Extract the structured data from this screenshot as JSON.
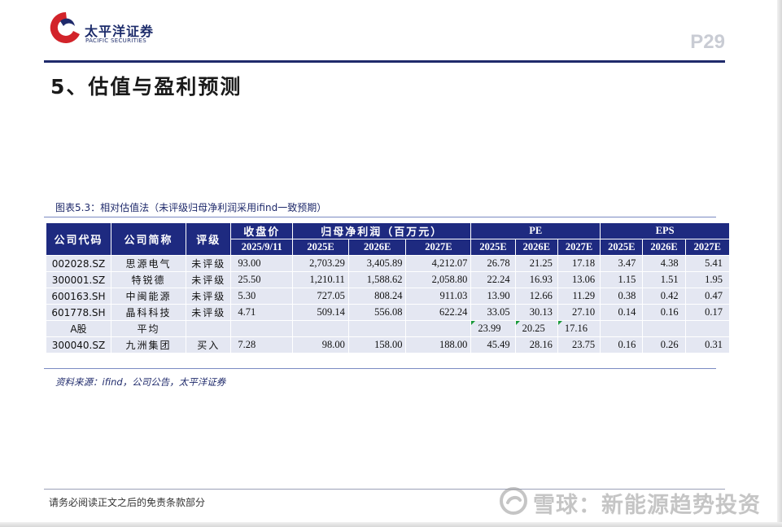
{
  "header": {
    "brand_cn": "太平洋证券",
    "brand_en": "PACIFIC SECURITIES",
    "page_number": "P29"
  },
  "section_title": "5、估值与盈利预测",
  "figure": {
    "caption": "图表5.3：相对估值法（未评级归母净利润采用ifind一致预期）",
    "source": "资料来源：ifind，公司公告，太平洋证券"
  },
  "table": {
    "headers": {
      "code": "公司代码",
      "name": "公司简称",
      "rating": "评级",
      "close": "收盘价",
      "close_date": "2025/9/11",
      "profit": "归母净利润（百万元）",
      "pe": "PE",
      "eps": "EPS",
      "years": [
        "2025E",
        "2026E",
        "2027E"
      ]
    },
    "rows": [
      {
        "code": "002028.SZ",
        "name": "思源电气",
        "rating": "未评级",
        "close": "93.00",
        "profit": [
          "2,703.29",
          "3,405.89",
          "4,212.07"
        ],
        "pe": [
          "26.78",
          "21.25",
          "17.18"
        ],
        "eps": [
          "3.47",
          "4.38",
          "5.41"
        ]
      },
      {
        "code": "300001.SZ",
        "name": "特锐德",
        "rating": "未评级",
        "close": "25.50",
        "profit": [
          "1,210.11",
          "1,588.62",
          "2,058.80"
        ],
        "pe": [
          "22.24",
          "16.93",
          "13.06"
        ],
        "eps": [
          "1.15",
          "1.51",
          "1.95"
        ]
      },
      {
        "code": "600163.SH",
        "name": "中闽能源",
        "rating": "未评级",
        "close": "5.30",
        "profit": [
          "727.05",
          "808.24",
          "911.03"
        ],
        "pe": [
          "13.90",
          "12.66",
          "11.29"
        ],
        "eps": [
          "0.38",
          "0.42",
          "0.47"
        ]
      },
      {
        "code": "601778.SH",
        "name": "晶科科技",
        "rating": "未评级",
        "close": "4.71",
        "profit": [
          "509.14",
          "556.08",
          "622.24"
        ],
        "pe": [
          "33.05",
          "30.13",
          "27.10"
        ],
        "eps": [
          "0.14",
          "0.16",
          "0.17"
        ]
      },
      {
        "code": "A股",
        "name": "平均",
        "rating": "",
        "close": "",
        "profit": [
          "",
          "",
          ""
        ],
        "pe": [
          "23.99",
          "20.25",
          "17.16"
        ],
        "eps": [
          "",
          "",
          ""
        ]
      },
      {
        "code": "300040.SZ",
        "name": "九洲集团",
        "rating": "买入",
        "close": "7.28",
        "profit": [
          "98.00",
          "158.00",
          "188.00"
        ],
        "pe": [
          "45.49",
          "28.16",
          "23.75"
        ],
        "eps": [
          "0.16",
          "0.26",
          "0.31"
        ]
      }
    ]
  },
  "footer": {
    "disclaimer": "请务必阅读正文之后的免责条款部分",
    "watermark": "雪球：新能源趋势投资"
  },
  "colors": {
    "brand_navy": "#1f2a6b",
    "header_fill": "#1e2a80",
    "cell_fill": "#e4e7f2",
    "logo_red": "#d2232a"
  }
}
